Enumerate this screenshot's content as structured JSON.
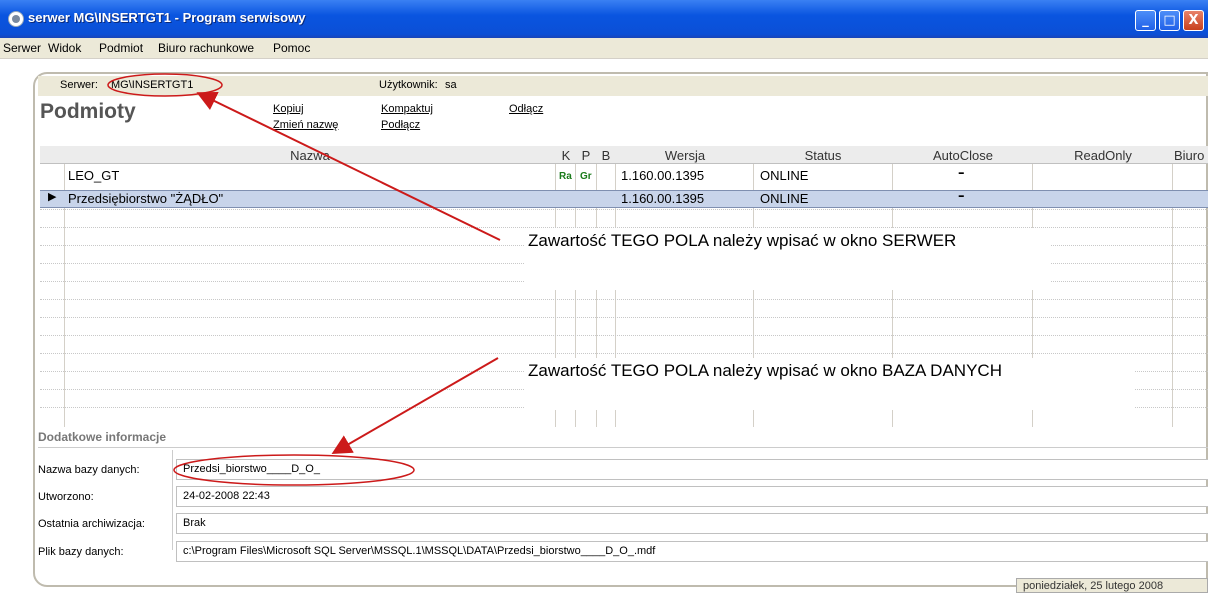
{
  "window": {
    "title": "serwer MG\\INSERTGT1 - Program serwisowy",
    "minimize": "_",
    "maximize": "□",
    "close": "X"
  },
  "menu": [
    {
      "label": "Serwer"
    },
    {
      "label": "Widok"
    },
    {
      "label": "Podmiot"
    },
    {
      "label": "Biuro rachunkowe"
    },
    {
      "label": "Pomoc"
    }
  ],
  "serverbar": {
    "server_label": "Serwer:",
    "server_value": "MG\\INSERTGT1",
    "user_label": "Użytkownik:",
    "user_value": "sa"
  },
  "heading": "Podmioty",
  "actions": {
    "copy": "Kopiuj",
    "rename": "Zmień nazwę",
    "compact": "Kompaktuj",
    "attach": "Podłącz",
    "detach": "Odłącz"
  },
  "grid": {
    "columns": [
      "Nazwa",
      "K",
      "P",
      "B",
      "Wersja",
      "Status",
      "AutoClose",
      "ReadOnly",
      "Biuro"
    ],
    "rows": [
      {
        "name": "LEO_GT",
        "k": "Ra",
        "p": "Gr",
        "version": "1.160.00.1395",
        "status": "ONLINE",
        "autoclose": "–",
        "selected": false
      },
      {
        "name": "Przedsiębiorstwo \"ŻĄDŁO\"",
        "k": "",
        "p": "",
        "version": "1.160.00.1395",
        "status": "ONLINE",
        "autoclose": "–",
        "selected": true
      }
    ],
    "row_marker": "▶"
  },
  "annotations": {
    "server_note": "Zawartość TEGO POLA należy wpisać w okno SERWER",
    "db_note": "Zawartość TEGO POLA należy wpisać w okno BAZA DANYCH",
    "color": "#cc1a1a"
  },
  "details": {
    "title": "Dodatkowe informacje",
    "rows": [
      {
        "label": "Nazwa bazy danych:",
        "value": "Przedsi_biorstwo____D_O_"
      },
      {
        "label": "Utworzono:",
        "value": "24-02-2008 22:43"
      },
      {
        "label": "Ostatnia archiwizacja:",
        "value": "Brak"
      },
      {
        "label": "Plik bazy danych:",
        "value": "c:\\Program Files\\Microsoft SQL Server\\MSSQL.1\\MSSQL\\DATA\\Przedsi_biorstwo____D_O_.mdf"
      }
    ]
  },
  "statusbar": {
    "date": "poniedziałek, 25 lutego 2008"
  }
}
